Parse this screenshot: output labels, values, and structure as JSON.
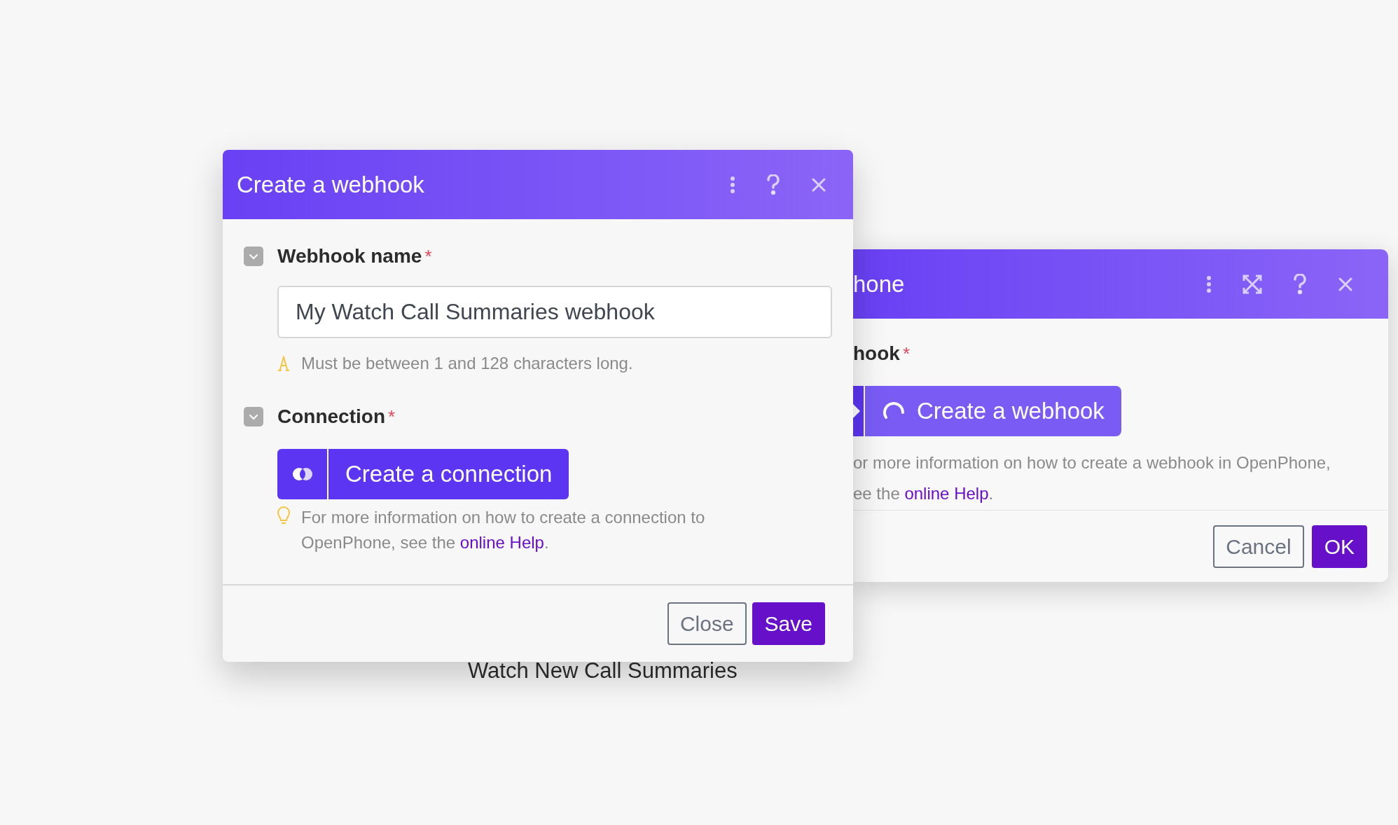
{
  "background_label": "Watch New Call Summaries",
  "back_dialog": {
    "title": "hone",
    "field_label": "hook",
    "required_mark": "*",
    "button": "Create a webhook",
    "help_line": "or more information on how to create a webhook in OpenPhone,",
    "help_lead": "ee the ",
    "help_link": "online Help",
    "help_tail": ".",
    "buttons": [
      {
        "label": "Cancel",
        "kind": "secondary"
      },
      {
        "label": "OK",
        "kind": "primary"
      }
    ]
  },
  "dialog": {
    "title": "Create a webhook",
    "fields": [
      {
        "kind": "text",
        "label": "Webhook name",
        "required_mark": "*",
        "value": "My Watch Call Summaries webhook",
        "hint": "Must be between 1 and 128 characters long."
      },
      {
        "kind": "connection",
        "label": "Connection",
        "required_mark": "*",
        "button": "Create a connection",
        "help_text": "For more information on how to create a connection to OpenPhone, see the ",
        "help_link": "online Help",
        "help_tail": "."
      }
    ],
    "buttons": [
      {
        "label": "Close",
        "kind": "secondary"
      },
      {
        "label": "Save",
        "kind": "primary"
      }
    ]
  }
}
